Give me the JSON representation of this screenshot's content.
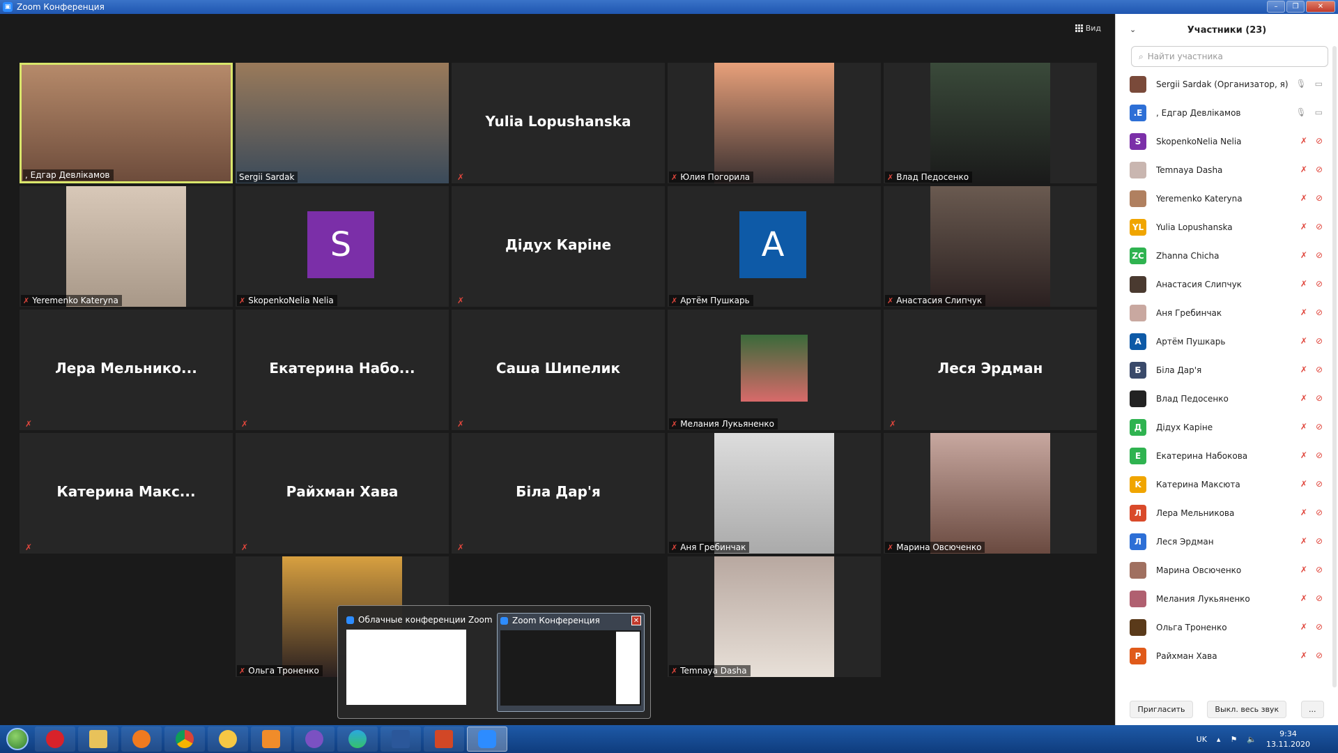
{
  "window": {
    "title": "Zoom Конференция"
  },
  "view_label": "Вид",
  "tiles": [
    {
      "name": ", Едгар Девлікамов",
      "video": true,
      "muted": false,
      "active": true
    },
    {
      "name": "Sergii Sardak",
      "video": true,
      "muted": false
    },
    {
      "name": "Yulia Lopushanska",
      "video": false,
      "muted": true
    },
    {
      "name": "Юлия Погорила",
      "video": true,
      "muted": true
    },
    {
      "name": "Влад Педосенко",
      "video": true,
      "muted": true
    },
    {
      "name": "Yeremenko Kateryna",
      "video": true,
      "muted": true
    },
    {
      "name": "SkopenkoNelia Nelia",
      "avatar": "S",
      "muted": true
    },
    {
      "name": "Дідух Каріне",
      "video": false,
      "muted": true
    },
    {
      "name": "Артём Пушкарь",
      "avatar": "A",
      "muted": true
    },
    {
      "name": "Анастасия Слипчук",
      "video": true,
      "muted": true
    },
    {
      "name": "Лера  Мельнико...",
      "video": false,
      "muted": true
    },
    {
      "name": "Екатерина  Набо...",
      "video": false,
      "muted": true
    },
    {
      "name": "Саша Шипелик",
      "video": false,
      "muted": true
    },
    {
      "name": "Мелания Лукьяненко",
      "video": true,
      "muted": true
    },
    {
      "name": "Леся Эрдман",
      "video": false,
      "muted": true
    },
    {
      "name": "Катерина  Макс...",
      "video": false,
      "muted": true
    },
    {
      "name": "Райхман Хава",
      "video": false,
      "muted": true
    },
    {
      "name": "Біла Дар'я",
      "video": false,
      "muted": true
    },
    {
      "name": "Аня Гребинчак",
      "video": true,
      "muted": true
    },
    {
      "name": "Марина Овсюченко",
      "video": true,
      "muted": true
    },
    {
      "name": "Ольга Троненко",
      "video": true,
      "muted": true
    },
    {
      "name": "Temnaya Dasha",
      "video": true,
      "muted": true
    }
  ],
  "panel": {
    "title": "Участники (23)",
    "search_placeholder": "Найти участника",
    "participants": [
      {
        "name": "Sergii Sardak (Организатор, я)",
        "initial": "",
        "color": "#7a4a3a",
        "mic": "on"
      },
      {
        "name": ", Едгар Девлікамов",
        "initial": ".E",
        "color": "#2d6fd6",
        "mic": "on"
      },
      {
        "name": "SkopenkoNelia Nelia",
        "initial": "S",
        "color": "#7b2fa8",
        "mic": "off"
      },
      {
        "name": "Temnaya Dasha",
        "initial": "",
        "color": "#c9b6b0",
        "mic": "off"
      },
      {
        "name": "Yeremenko Kateryna",
        "initial": "",
        "color": "#b08060",
        "mic": "off"
      },
      {
        "name": "Yulia Lopushanska",
        "initial": "YL",
        "color": "#f0a500",
        "mic": "off"
      },
      {
        "name": "Zhanna Chicha",
        "initial": "ZC",
        "color": "#2fb350",
        "mic": "off"
      },
      {
        "name": "Анастасия Слипчук",
        "initial": "",
        "color": "#4a3a30",
        "mic": "off"
      },
      {
        "name": "Аня Гребинчак",
        "initial": "",
        "color": "#c9a8a0",
        "mic": "off"
      },
      {
        "name": "Артём Пушкарь",
        "initial": "A",
        "color": "#0e5aa7",
        "mic": "off"
      },
      {
        "name": "Біла Дар'я",
        "initial": "Б",
        "color": "#3a4a6a",
        "mic": "off"
      },
      {
        "name": "Влад Педосенко",
        "initial": "",
        "color": "#222222",
        "mic": "off"
      },
      {
        "name": "Дідух Каріне",
        "initial": "Д",
        "color": "#2fb350",
        "mic": "off"
      },
      {
        "name": "Екатерина Набокова",
        "initial": "E",
        "color": "#2fb350",
        "mic": "off"
      },
      {
        "name": "Катерина Максюта",
        "initial": "K",
        "color": "#f0a500",
        "mic": "off"
      },
      {
        "name": "Лера Мельникова",
        "initial": "Л",
        "color": "#d94a2a",
        "mic": "off"
      },
      {
        "name": "Леся Эрдман",
        "initial": "Л",
        "color": "#2d6fd6",
        "mic": "off"
      },
      {
        "name": "Марина Овсюченко",
        "initial": "",
        "color": "#a07060",
        "mic": "off"
      },
      {
        "name": "Мелания Лукьяненко",
        "initial": "",
        "color": "#b06070",
        "mic": "off"
      },
      {
        "name": "Ольга Троненко",
        "initial": "",
        "color": "#5a3a1a",
        "mic": "off"
      },
      {
        "name": "Райхман Хава",
        "initial": "P",
        "color": "#e05a1a",
        "mic": "off"
      }
    ],
    "invite": "Пригласить",
    "mute_all": "Выкл. весь звук",
    "more": "..."
  },
  "preview": {
    "item1": "Облачные конференции Zoom",
    "item2": "Zoom Конференция"
  },
  "tray": {
    "lang": "UK",
    "time": "9:34",
    "date": "13.11.2020"
  }
}
